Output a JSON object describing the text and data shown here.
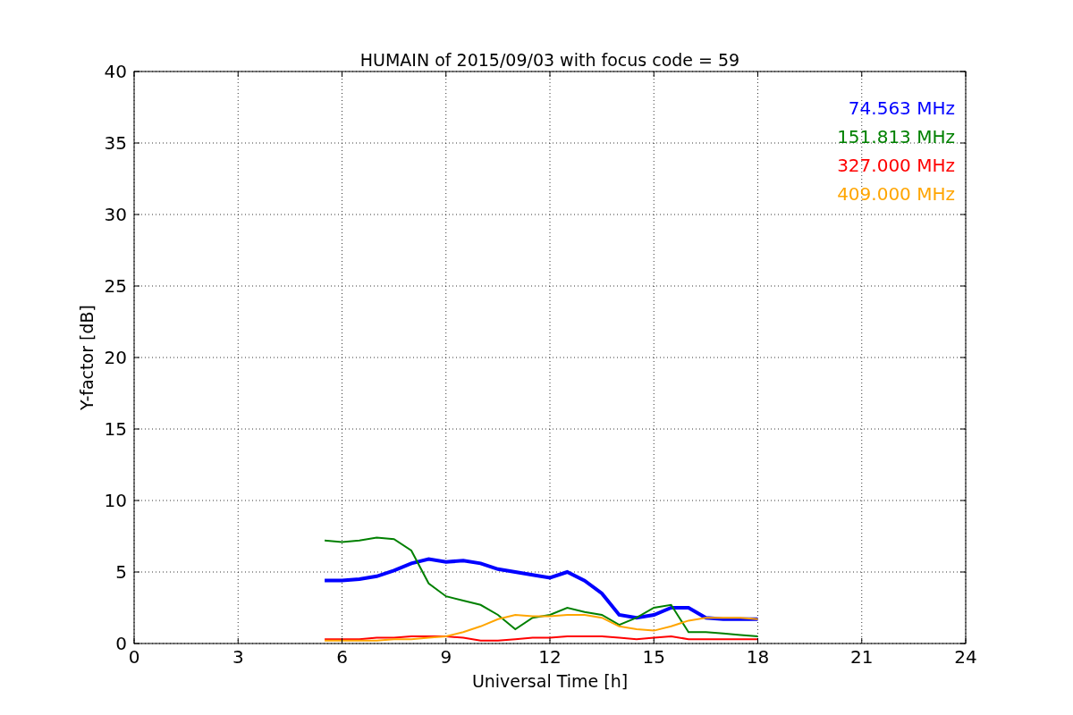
{
  "chart_data": {
    "type": "line",
    "title": "HUMAIN of 2015/09/03 with focus code = 59",
    "xlabel": "Universal Time [h]",
    "ylabel": "Y-factor [dB]",
    "x": [
      5.5,
      6,
      6.5,
      7,
      7.5,
      8,
      8.5,
      9,
      9.5,
      10,
      10.5,
      11,
      11.5,
      12,
      12.5,
      13,
      13.5,
      14,
      14.5,
      15,
      15.5,
      16,
      16.5,
      17,
      17.5,
      18
    ],
    "series": [
      {
        "name": "74.563 MHz",
        "color": "#0000ff",
        "values": [
          4.4,
          4.4,
          4.5,
          4.7,
          5.1,
          5.6,
          5.9,
          5.7,
          5.8,
          5.6,
          5.2,
          5.0,
          4.8,
          4.6,
          5.0,
          4.4,
          3.5,
          2.0,
          1.8,
          2.0,
          2.5,
          2.5,
          1.8,
          1.7,
          1.7,
          1.7
        ]
      },
      {
        "name": "151.813 MHz",
        "color": "#008000",
        "values": [
          7.2,
          7.1,
          7.2,
          7.4,
          7.3,
          6.5,
          4.2,
          3.3,
          3.0,
          2.7,
          2.0,
          1.0,
          1.8,
          2.0,
          2.5,
          2.2,
          2.0,
          1.3,
          1.8,
          2.5,
          2.7,
          0.8,
          0.8,
          0.7,
          0.6,
          0.5
        ]
      },
      {
        "name": "327.000 MHz",
        "color": "#ff0000",
        "values": [
          0.3,
          0.3,
          0.3,
          0.4,
          0.4,
          0.5,
          0.5,
          0.5,
          0.4,
          0.2,
          0.2,
          0.3,
          0.4,
          0.4,
          0.5,
          0.5,
          0.5,
          0.4,
          0.3,
          0.4,
          0.5,
          0.3,
          0.3,
          0.3,
          0.3,
          0.3
        ]
      },
      {
        "name": "409.000 MHz",
        "color": "#ffa500",
        "values": [
          0.2,
          0.2,
          0.2,
          0.2,
          0.3,
          0.3,
          0.4,
          0.5,
          0.8,
          1.2,
          1.7,
          2.0,
          1.9,
          1.9,
          2.0,
          2.0,
          1.8,
          1.2,
          1.0,
          0.9,
          1.2,
          1.6,
          1.8,
          1.8,
          1.8,
          1.7
        ]
      }
    ],
    "xlim": [
      0,
      24
    ],
    "ylim": [
      0,
      40
    ],
    "xticks": [
      0,
      3,
      6,
      9,
      12,
      15,
      18,
      21,
      24
    ],
    "yticks": [
      0,
      5,
      10,
      15,
      20,
      25,
      30,
      35,
      40
    ],
    "grid": true
  }
}
